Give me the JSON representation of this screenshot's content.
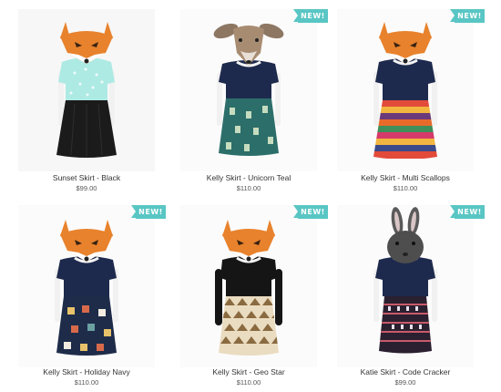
{
  "products": [
    {
      "name": "Sunset Skirt - Black",
      "price": "$99.00",
      "badge": "",
      "mask": "fox",
      "top_color": "#aeeae4",
      "skirt_color": "#1b1b1b",
      "skirt_pattern": "plain"
    },
    {
      "name": "Kelly Skirt - Unicorn Teal",
      "price": "$110.00",
      "badge": "NEW!",
      "mask": "deer",
      "top_color": "#1e2a4d",
      "skirt_color": "#2c6e6a",
      "skirt_pattern": "unicorn"
    },
    {
      "name": "Kelly Skirt - Multi Scallops",
      "price": "$110.00",
      "badge": "NEW!",
      "mask": "fox",
      "top_color": "#1e2a4d",
      "skirt_color": "#e24a3a",
      "skirt_pattern": "stripes"
    },
    {
      "name": "Kelly Skirt - Holiday Navy",
      "price": "$110.00",
      "badge": "NEW!",
      "mask": "fox",
      "top_color": "#1e2a4d",
      "skirt_color": "#1e2c4a",
      "skirt_pattern": "holiday"
    },
    {
      "name": "Kelly Skirt - Geo Star",
      "price": "$110.00",
      "badge": "NEW!",
      "mask": "fox",
      "top_color": "#151515",
      "skirt_color": "#eadcc0",
      "skirt_pattern": "geo"
    },
    {
      "name": "Katie Skirt - Code Cracker",
      "price": "$99.00",
      "badge": "NEW!",
      "mask": "rabbit",
      "top_color": "#1e2a4d",
      "skirt_color": "#2a2030",
      "skirt_pattern": "code"
    }
  ],
  "colors": {
    "badge": "#59c6c4",
    "fox_orange": "#e8822c"
  }
}
